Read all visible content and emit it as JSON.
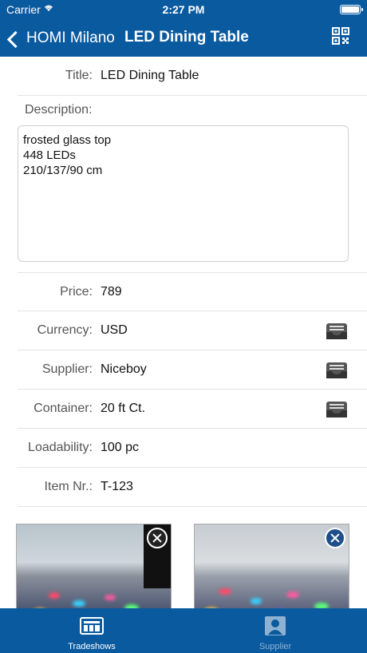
{
  "status": {
    "carrier": "Carrier",
    "time": "2:27 PM"
  },
  "nav": {
    "back_label": "HOMI Milano",
    "title": "LED Dining Table",
    "qr_icon": "qr-code-icon"
  },
  "form": {
    "title_label": "Title:",
    "title_value": "LED Dining Table",
    "description_label": "Description:",
    "description_lines": [
      "frosted glass top",
      "448 LEDs",
      "210/137/90 cm"
    ],
    "price_label": "Price:",
    "price_value": "789",
    "currency_label": "Currency:",
    "currency_value": "USD",
    "supplier_label": "Supplier:",
    "supplier_value": "Niceboy",
    "container_label": "Container:",
    "container_value": "20 ft Ct.",
    "loadability_label": "Loadability:",
    "loadability_value": "100 pc",
    "itemnr_label": "Item Nr.:",
    "itemnr_value": "T-123"
  },
  "tabs": [
    {
      "label": "Tradeshows",
      "icon": "tradeshows-icon",
      "active": true
    },
    {
      "label": "Supplier",
      "icon": "supplier-icon",
      "active": false
    }
  ],
  "colors": {
    "brand": "#0a5aa0"
  }
}
